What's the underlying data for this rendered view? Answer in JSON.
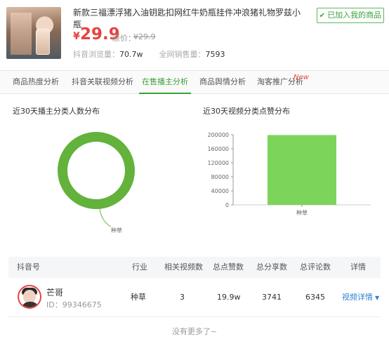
{
  "product": {
    "title": "新款三福漂浮猪入油钥匙扣网红牛奶瓶挂件冲浪猪礼物罗兹小瓶",
    "added_label": "已加入我的商品",
    "currency": "¥",
    "price": "29.9",
    "orig_label": "原价：",
    "orig_price": "¥29.9",
    "stats": [
      {
        "label": "抖音浏览量：",
        "value": "70.7w"
      },
      {
        "label": "全网销售量：",
        "value": "7593"
      }
    ]
  },
  "tabs": [
    "商品热度分析",
    "抖音关联视频分析",
    "在售播主分析",
    "商品舆情分析",
    "淘客推广分析"
  ],
  "active_tab": "在售播主分析",
  "new_badge": "New",
  "charts": {
    "left_title": "近30天播主分类人数分布",
    "right_title": "近30天视频分类点赞分布"
  },
  "chart_data": [
    {
      "type": "pie",
      "title": "近30天播主分类人数分布",
      "labels": [
        "种草"
      ],
      "values": [
        1
      ],
      "colors": [
        "#62b23b"
      ]
    },
    {
      "type": "bar",
      "title": "近30天视频分类点赞分布",
      "categories": [
        "种草"
      ],
      "values": [
        199000
      ],
      "yticks": [
        0,
        40000,
        80000,
        120000,
        160000,
        200000
      ],
      "ylim": [
        0,
        200000
      ],
      "colors": [
        "#7dd45a"
      ]
    }
  ],
  "table": {
    "headers": [
      "抖音号",
      "行业",
      "相关视频数",
      "总点赞数",
      "总分享数",
      "总评论数",
      "详情"
    ],
    "rows": [
      {
        "name": "芒哥",
        "uid": "ID：99346675",
        "industry": "种草",
        "videos": "3",
        "likes": "19.9w",
        "shares": "3741",
        "comments": "6345",
        "detail": "视频详情"
      }
    ]
  },
  "footer": "没有更多了~"
}
